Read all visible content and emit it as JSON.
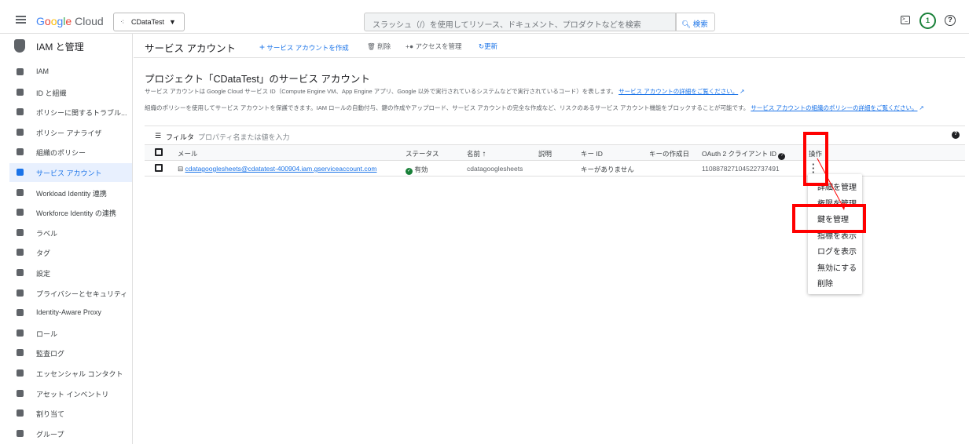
{
  "topbar": {
    "logo": "Google Cloud",
    "project": "CDataTest",
    "search_placeholder": "スラッシュ（/）を使用してリソース、ドキュメント、プロダクトなどを検索",
    "search_button": "検索",
    "notification_count": "1"
  },
  "sidebar": {
    "title": "IAM と管理",
    "items": [
      {
        "label": "IAM",
        "icon": "person-add-icon"
      },
      {
        "label": "ID と組織",
        "icon": "account-circle-icon"
      },
      {
        "label": "ポリシーに関するトラブル...",
        "icon": "wrench-icon"
      },
      {
        "label": "ポリシー アナライザ",
        "icon": "analyzer-icon"
      },
      {
        "label": "組織のポリシー",
        "icon": "policy-icon"
      },
      {
        "label": "サービス アカウント",
        "icon": "service-account-icon",
        "active": true
      },
      {
        "label": "Workload Identity 連携",
        "icon": "id-card-icon"
      },
      {
        "label": "Workforce Identity の連携",
        "icon": "list-icon"
      },
      {
        "label": "ラベル",
        "icon": "label-icon"
      },
      {
        "label": "タグ",
        "icon": "tag-icon"
      },
      {
        "label": "設定",
        "icon": "gear-icon"
      },
      {
        "label": "プライバシーとセキュリティ",
        "icon": "shield-icon"
      },
      {
        "label": "Identity-Aware Proxy",
        "icon": "proxy-icon"
      },
      {
        "label": "ロール",
        "icon": "role-icon"
      },
      {
        "label": "監査ログ",
        "icon": "log-icon"
      },
      {
        "label": "エッセンシャル コンタクト",
        "icon": "contact-icon"
      },
      {
        "label": "アセット インベントリ",
        "icon": "inventory-icon"
      },
      {
        "label": "割り当て",
        "icon": "quota-icon"
      },
      {
        "label": "グループ",
        "icon": "group-icon"
      }
    ]
  },
  "header": {
    "title": "サービス アカウント",
    "create": "サービス アカウントを作成",
    "delete": "削除",
    "manage_access": "アクセスを管理",
    "refresh": "更新"
  },
  "main": {
    "heading": "プロジェクト「CDataTest」のサービス アカウント",
    "desc1": "サービス アカウントは Google Cloud サービス ID（Compute Engine VM、App Engine アプリ、Google 以外で実行されているシステムなどで実行されているコード）を表します。",
    "desc1_link": "サービス アカウントの詳細をご覧ください。",
    "desc2": "組織のポリシーを使用してサービス アカウントを保護できます。IAM ロールの自動付与、鍵の作成やアップロード、サービス アカウントの完全な作成など、リスクのあるサービス アカウント機能をブロックすることが可能です。",
    "desc2_link": "サービス アカウントの組織のポリシーの詳細をご覧ください。",
    "filter_label": "フィルタ",
    "filter_placeholder": "プロパティ名または値を入力"
  },
  "table": {
    "headers": {
      "email": "メール",
      "status": "ステータス",
      "name": "名前",
      "description": "説明",
      "key_id": "キー ID",
      "key_date": "キーの作成日",
      "oauth": "OAuth 2 クライアント ID",
      "actions": "操作"
    },
    "rows": [
      {
        "email": "cdatagooglesheets@cdatatest-400904.iam.gserviceaccount.com",
        "status": "有効",
        "name": "cdatagooglesheets",
        "description": "",
        "key_id": "キーがありません",
        "key_date": "",
        "oauth": "110887827104522737491"
      }
    ]
  },
  "menu": {
    "items": [
      "詳細を管理",
      "権限を管理",
      "鍵を管理",
      "指標を表示",
      "ログを表示",
      "無効にする",
      "削除"
    ]
  },
  "colors": {
    "accent": "#1a73e8",
    "highlight": "#ff0000",
    "success": "#188038"
  }
}
